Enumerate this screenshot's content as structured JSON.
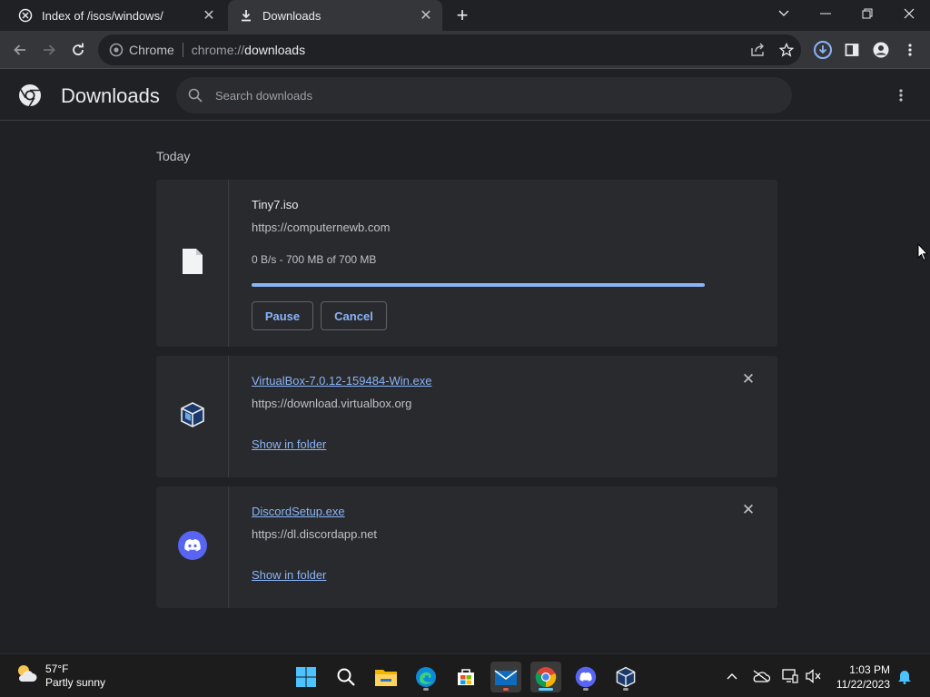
{
  "window": {
    "tabs": [
      {
        "label": "Index of /isos/windows/",
        "active": false
      },
      {
        "label": "Downloads",
        "active": true
      }
    ]
  },
  "omnibox": {
    "site_label": "Chrome",
    "url_scheme": "chrome://",
    "url_host": "downloads"
  },
  "page": {
    "title": "Downloads",
    "search_placeholder": "Search downloads",
    "day_label": "Today"
  },
  "downloads": [
    {
      "filename": "Tiny7.iso",
      "source": "https://computernewb.com",
      "status": "0 B/s - 700 MB of 700 MB",
      "progress": 1.0,
      "pause_label": "Pause",
      "cancel_label": "Cancel",
      "icon": "file-icon"
    },
    {
      "filename": "VirtualBox-7.0.12-159484-Win.exe",
      "source": "https://download.virtualbox.org",
      "action": "Show in folder",
      "icon": "virtualbox-icon"
    },
    {
      "filename": "DiscordSetup.exe",
      "source": "https://dl.discordapp.net",
      "action": "Show in folder",
      "icon": "discord-icon"
    }
  ],
  "taskbar": {
    "weather_temp": "57°F",
    "weather_desc": "Partly sunny",
    "time": "1:03 PM",
    "date": "11/22/2023",
    "apps": [
      "start-icon",
      "search-icon",
      "file-explorer-icon",
      "edge-icon",
      "store-icon",
      "mail-icon",
      "chrome-icon",
      "discord-icon",
      "virtualbox-icon"
    ]
  },
  "colors": {
    "background": "#202124",
    "accent": "#8ab4f8",
    "card": "#292a2d",
    "toolbar": "#35363a"
  }
}
